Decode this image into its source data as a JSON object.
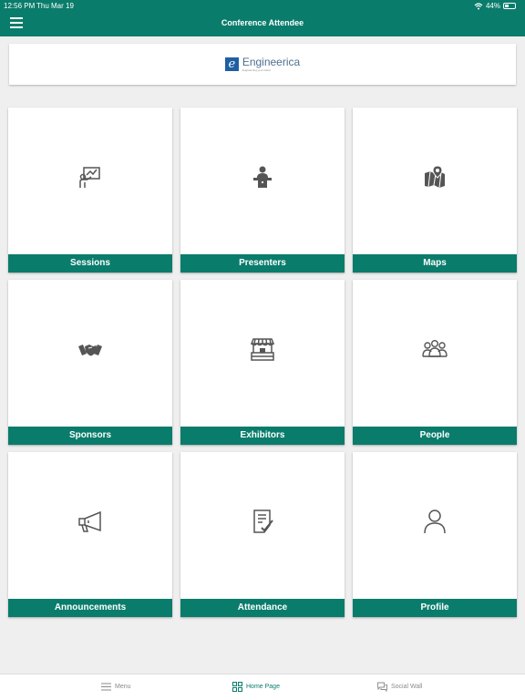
{
  "status_bar": {
    "time": "12:56 PM",
    "date": "Thu Mar 19",
    "battery": "44%",
    "battery_level": 0.44
  },
  "header": {
    "title": "Conference Attendee"
  },
  "banner": {
    "logo_text": "Engineerica",
    "logo_tagline": "Engineering your future",
    "logo_mark": "e"
  },
  "tiles": [
    {
      "label": "Sessions",
      "icon": "presentation-board-icon"
    },
    {
      "label": "Presenters",
      "icon": "speaker-podium-icon"
    },
    {
      "label": "Maps",
      "icon": "map-pin-icon"
    },
    {
      "label": "Sponsors",
      "icon": "handshake-icon"
    },
    {
      "label": "Exhibitors",
      "icon": "booth-stand-icon"
    },
    {
      "label": "People",
      "icon": "group-people-icon"
    },
    {
      "label": "Announcements",
      "icon": "megaphone-icon"
    },
    {
      "label": "Attendance",
      "icon": "checklist-icon"
    },
    {
      "label": "Profile",
      "icon": "person-icon"
    }
  ],
  "bottom_nav": [
    {
      "label": "Menu",
      "icon": "menu-lines-icon",
      "active": false
    },
    {
      "label": "Home Page",
      "icon": "grid-icon",
      "active": true
    },
    {
      "label": "Social Wall",
      "icon": "chat-bubbles-icon",
      "active": false
    }
  ],
  "colors": {
    "primary": "#0a7c6b",
    "background": "#efefef",
    "icon": "#555555"
  }
}
